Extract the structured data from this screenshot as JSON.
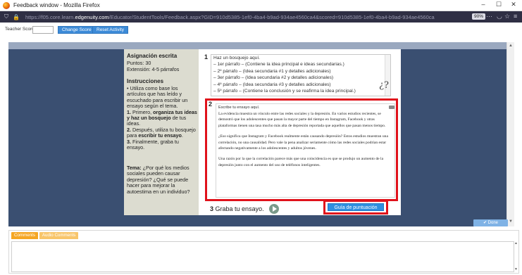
{
  "window": {
    "title": "Feedback window - Mozilla Firefox",
    "minimize": "–",
    "maximize": "☐",
    "close": "✕"
  },
  "browser": {
    "url_prefix": "https://f05.core.learn.",
    "url_domain": "edgenuity.com",
    "url_rest": "/Educator/StudentTools/Feedback.aspx?GID=910d5385-1ef0-4ba4-b9ad-934ae4560ca4&scored=910d5385-1ef0-4ba4-b9ad-934ae4560ca",
    "zoom": "90%",
    "more": "···",
    "colors": {
      "bar": "#2f2f44"
    }
  },
  "teacher": {
    "score_label": "Teacher Score",
    "score_value": "",
    "change_score": "Change Score",
    "reset_activity": "Reset Activity"
  },
  "assignment": {
    "title": "Asignación escrita",
    "points": "Puntos: 30",
    "extension": "Extensión: 4-5 párrafos",
    "instructions_heading": "Instrucciones",
    "instr_1": "• Utiliza como base los artículos que has leído y escuchado para escribir un ensayo según el tema.",
    "step_1_num": "1.",
    "step_1_pre": " Primero, ",
    "step_1_bold": "organiza tus ideas y haz un bosquejo",
    "step_1_post": " de tus ideas.",
    "step_2_num": "2.",
    "step_2_pre": " Después, utiliza tu bosquejo para ",
    "step_2_bold": "escribir tu ensayo",
    "step_2_post": ".",
    "step_3_num": "3.",
    "step_3_text": " Finalmente, graba tu ensayo.",
    "tema_label": "Tema:",
    "tema_text": " ¿Por qué los medios sociales pueden causar depresión? ¿Qué se puede hacer para mejorar la autoestima en un individuo?"
  },
  "question1": {
    "number": "1",
    "lines": [
      "Haz un bosquejo aquí.",
      "– 1er párrafo – (Contiene la idea principal e ideas secundarias.)",
      "– 2º párrafo – (Idea secundaria #1 y detalles adicionales)",
      "– 3er párrafo – (Idea secundaria #2 y detalles adicionales)",
      "– 4º párrafo – (Idea secundaria #3 y detalles adicionales)",
      "– 5º párrafo – (Contiene la conclusión y se reafirma la idea principal.)"
    ],
    "help_glyph": "¿?"
  },
  "question2": {
    "number": "2",
    "placeholder": "Escribe tu ensayo aquí.",
    "paragraphs": [
      "La evidencia muestra un vínculo entre las redes sociales y la depresión. En varios estudios recientes, se demostró que los adolescentes que pasan la mayor parte del tiempo en Instagram, Facebook y otras plataformas tienen una tasa mucho más alta de depresión reportada que aquellos que pasan menos tiempo.",
      "¿Eso significa que Instagram y Facebook realmente están causando depresión? Estos estudios muestran una correlación, no una causalidad. Pero vale la pena analizar seriamente cómo las redes sociales podrían estar afectando negativamente a los adolescentes y adultos jóvenes.",
      "Una razón por la que la correlación parece más que una coincidencia es que se produjo un aumento de la depresión junto con el aumento del uso de teléfonos inteligentes."
    ]
  },
  "question3": {
    "number": "3",
    "label": "Graba tu ensayo."
  },
  "guide_button": "Guía de puntuación",
  "done_button": "✔ Done",
  "comments": {
    "tab_comments": "Comments",
    "tab_audio": "Audio Comments",
    "text": ""
  },
  "accent": {
    "highlight_red": "#e0121b",
    "blue_button": "#2f8fe0",
    "orange_tab": "#f5a623"
  }
}
